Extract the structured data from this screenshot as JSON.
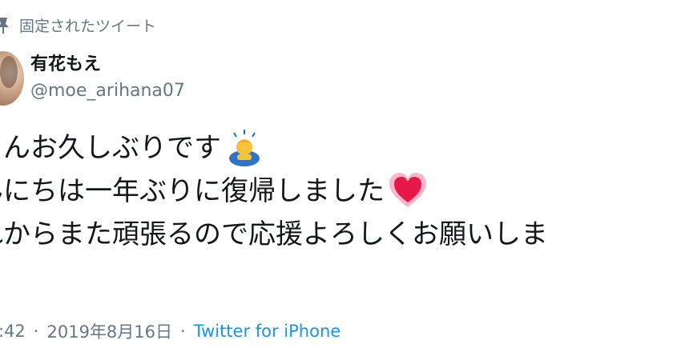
{
  "pinned_label": "固定されたツイート",
  "user": {
    "display_name": "有花もえ",
    "handle": "@moe_arihana07"
  },
  "tweet": {
    "lines": [
      "さんお久しぶりです",
      "んにちは一年ぶりに復帰しました",
      "れからまた頑張るので応援よろしくお願いしま"
    ]
  },
  "meta": {
    "time": ":42",
    "separator": "·",
    "date": "2019年8月16日",
    "source": "Twitter for iPhone"
  },
  "colors": {
    "muted": "#657786",
    "link": "#1b95e0",
    "text": "#14171a"
  },
  "icons": [
    "pin-icon",
    "avatar",
    "person-bowing-emoji",
    "beating-heart-emoji"
  ]
}
